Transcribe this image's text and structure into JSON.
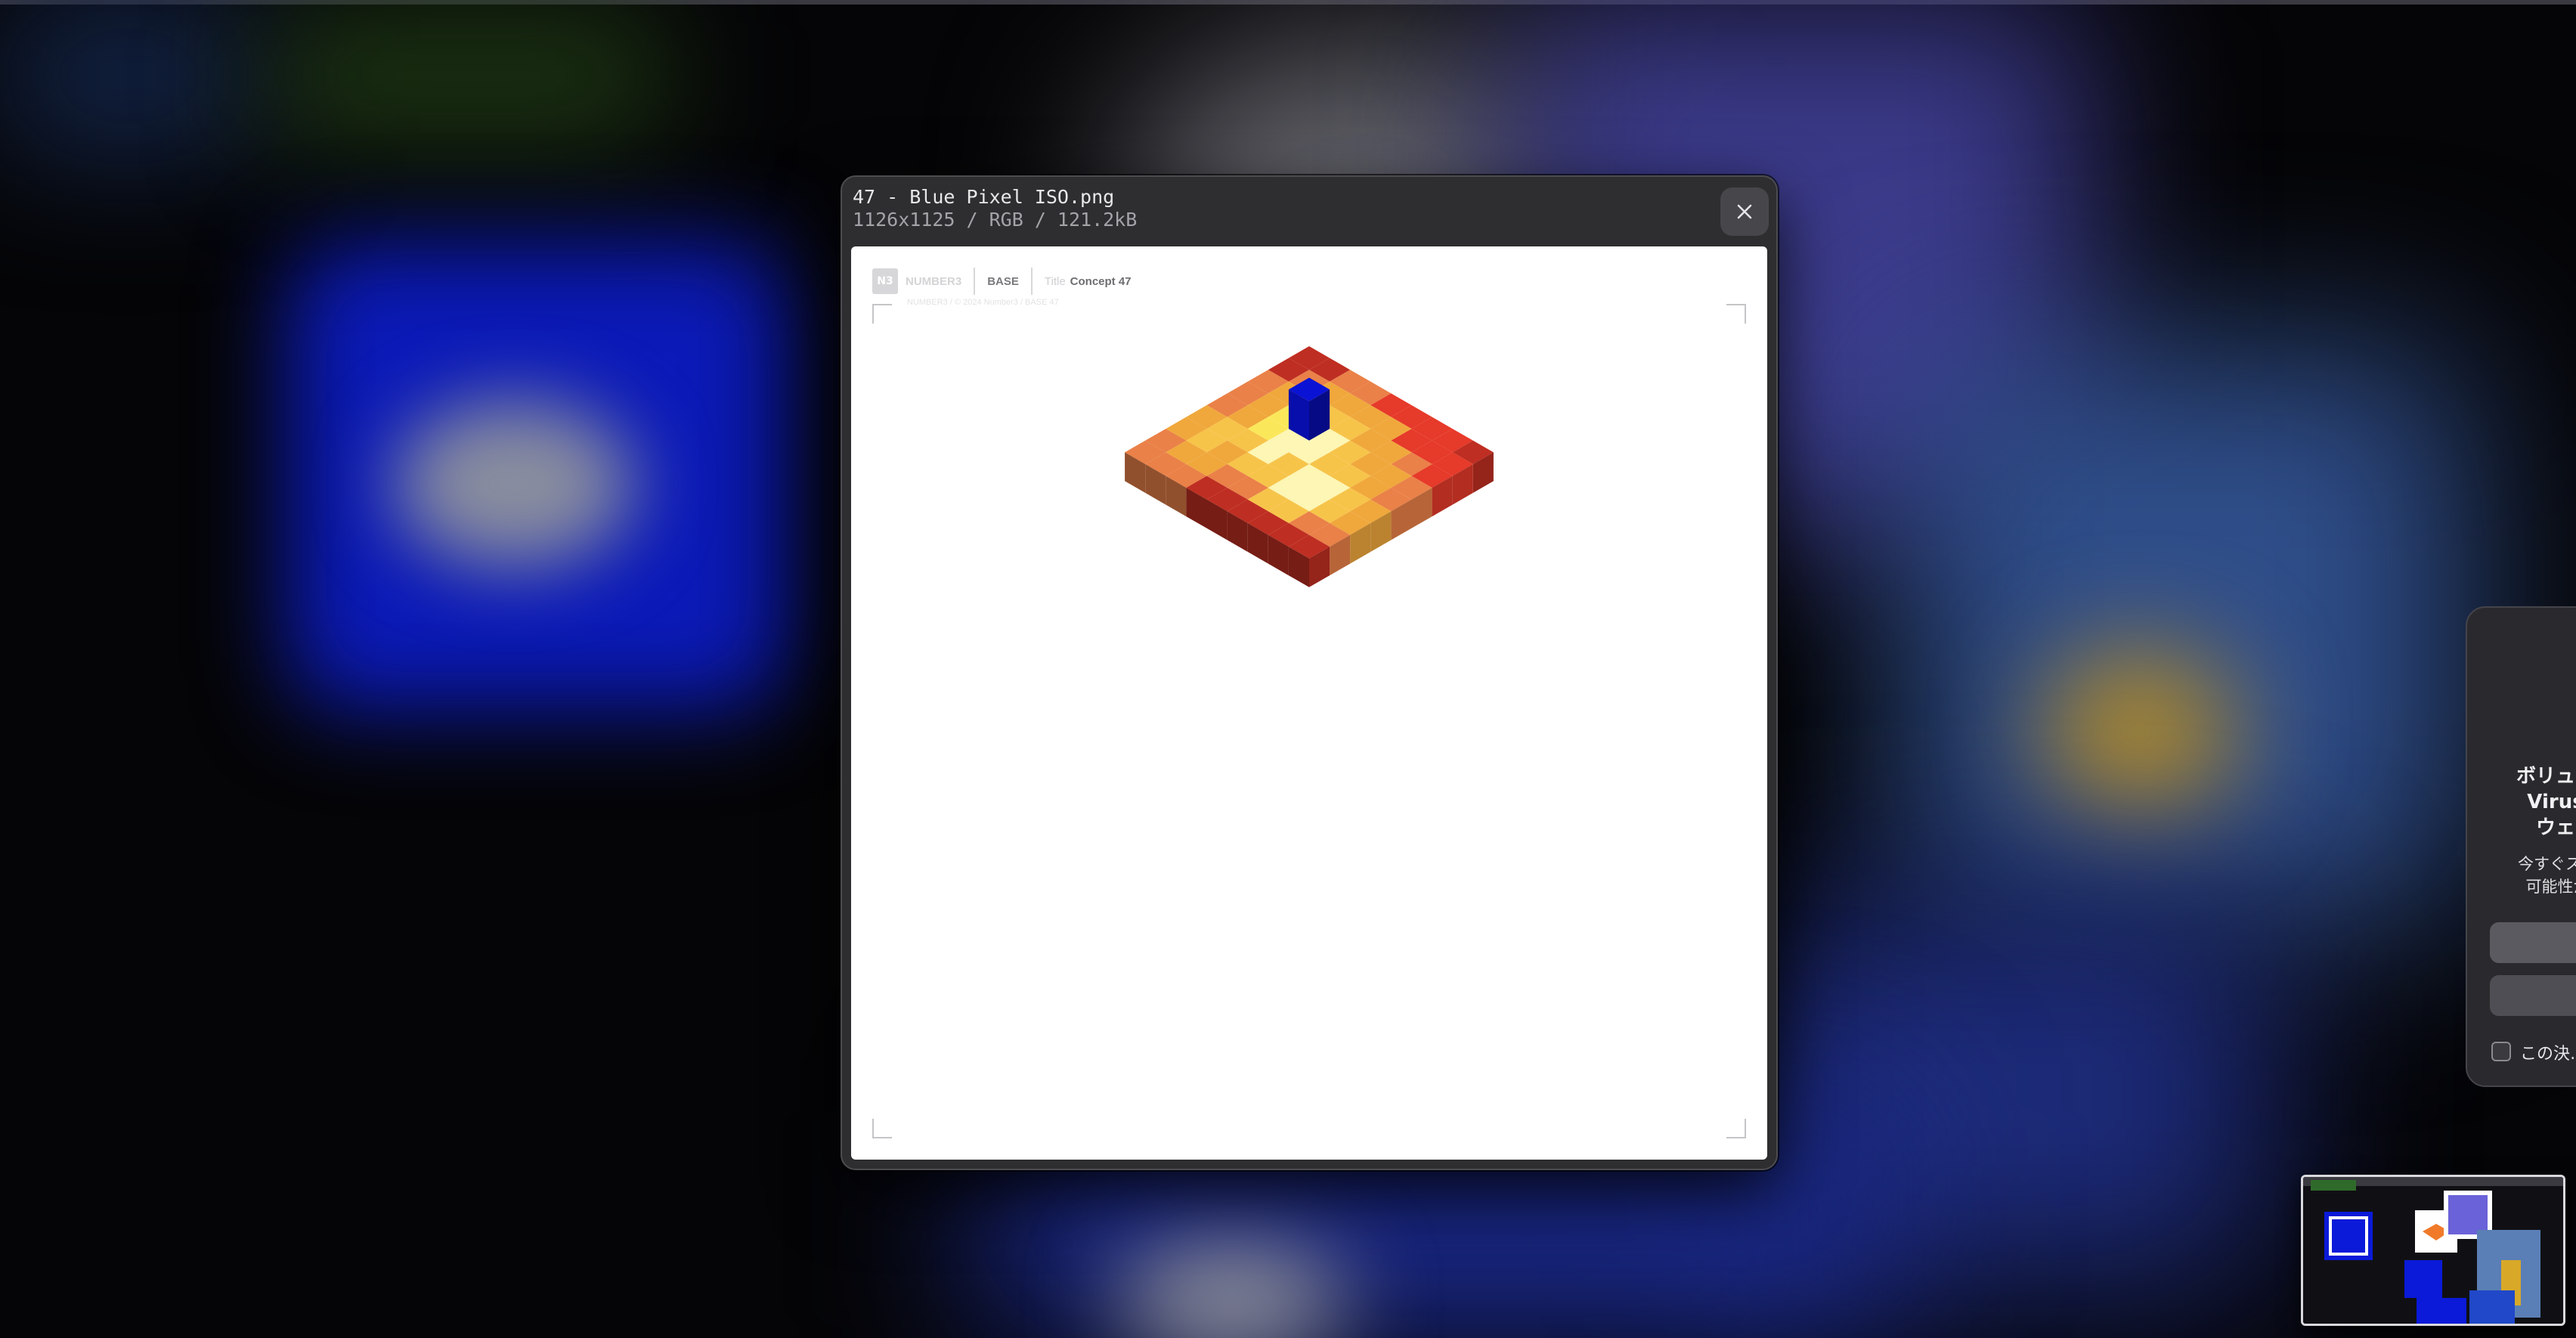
{
  "quicklook": {
    "filename": "47 - Blue Pixel ISO.png",
    "fileinfo": "1126x1125 / RGB / 121.2kB",
    "close_icon": "close-icon"
  },
  "preview": {
    "brand": "NUMBER3",
    "base_label": "BASE",
    "title_label": "Title",
    "title_value": "Concept 47",
    "sub_line": "NUMBER3 / © 2024 Number3 / BASE 47"
  },
  "alert": {
    "title": "ボリュー…\nVirus…\nウェ…",
    "body": "今すぐスキ…\n可能性が…",
    "checkbox_label": "この決…"
  },
  "colors": {
    "cube_blue": "#0a12d6",
    "deep_red": "#bf2e22",
    "red": "#e63a2a",
    "orange": "#ea8148",
    "amber": "#f0a83c",
    "gold": "#f7c44a",
    "yellow": "#fbe85a",
    "cream": "#fdf6b4"
  }
}
